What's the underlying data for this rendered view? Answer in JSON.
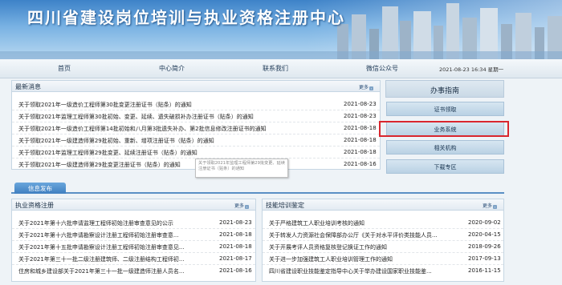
{
  "header": {
    "title": "四川省建设岗位培训与执业资格注册中心"
  },
  "nav": {
    "items": [
      "首页",
      "中心简介",
      "联系我们",
      "微信公众号"
    ],
    "datetime": "2021-08-23 16:34 星期一"
  },
  "news": {
    "title": "最新消息",
    "more": "更多",
    "rows": [
      {
        "text": "关于领取2021年一级造价工程师第30批变更注册证书（贴条）的通知",
        "date": "2021-08-23"
      },
      {
        "text": "关于领取2021年监理工程师第30批初始、变更、延续、遗失破损补办注册证书（贴条）的通知",
        "date": "2021-08-23"
      },
      {
        "text": "关于领取2021年一级造价工程师第14批初始和八月第3批遗失补办、第2批信息修改注册证书的通知",
        "date": "2021-08-18"
      },
      {
        "text": "关于领取2021年一级建造师第29批初始、重新、增项注册证书（贴条）的通知",
        "date": "2021-08-18"
      },
      {
        "text": "关于领取2021年监理工程师第29批变更、延续注册证书（贴条）的通知",
        "date": "2021-08-18"
      },
      {
        "text": "关于领取2021年一级建造师第29批变更注册证书（贴条）的通知",
        "date": "2021-08-16"
      }
    ]
  },
  "tooltip": {
    "text": "关于领取2021年监理工程师第29批变更、延续注册证书（贴条）的通知"
  },
  "sidebar": {
    "title": "办事指南",
    "buttons": [
      "证书领取",
      "业务系统",
      "相关机构",
      "下载专区"
    ]
  },
  "tabs": {
    "active": "信息发布"
  },
  "registration": {
    "title": "执业资格注册",
    "more": "更多",
    "rows": [
      {
        "text": "关于2021年第十六批申请监理工程师初始注册审查意见的公示",
        "date": "2021-08-23"
      },
      {
        "text": "关于2021年第十六批申请勘察设计注册工程师初始注册审查意...",
        "date": "2021-08-18"
      },
      {
        "text": "关于2021年第十五批申请勘察设计注册工程师初始注册审查意见...",
        "date": "2021-08-18"
      },
      {
        "text": "关于2021年第三十一批二级注册建筑师、二级注册结构工程师初...",
        "date": "2021-08-17"
      },
      {
        "text": "住房和城乡建设部关于2021年第三十一批一级建造师注册人员名...",
        "date": "2021-08-16"
      }
    ]
  },
  "training": {
    "title": "技能培训鉴定",
    "more": "更多",
    "rows": [
      {
        "text": "关于严格建筑工人职业培训考核的通知",
        "date": "2020-09-02"
      },
      {
        "text": "关于转发人力资源社会保障部办公厅《关于对水平评价类技能人员...",
        "date": "2020-04-15"
      },
      {
        "text": "关于开展考评人员资格复核登记换证工作的通知",
        "date": "2018-09-26"
      },
      {
        "text": "关于进一步加强建筑工人职业培训管理工作的通知",
        "date": "2017-09-13"
      },
      {
        "text": "四川省建设职业技能鉴定指导中心关于举办建设国家职业技能鉴...",
        "date": "2016-11-15"
      }
    ]
  }
}
